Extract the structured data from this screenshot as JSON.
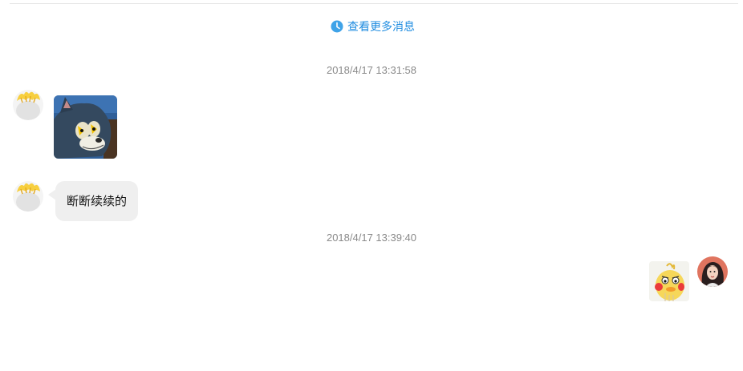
{
  "header": {
    "more_messages_label": "查看更多消息",
    "more_icon": "clock-icon",
    "accent_color": "#1f8ce0"
  },
  "timestamps": [
    "2018/4/17 13:31:58",
    "2018/4/17 13:39:40"
  ],
  "messages": [
    {
      "side": "left",
      "type": "image",
      "sticker": "tom-cat-sticker"
    },
    {
      "side": "left",
      "type": "text",
      "text": "断断续续的"
    },
    {
      "side": "right",
      "type": "image",
      "sticker": "yellow-duck-sticker"
    }
  ],
  "colors": {
    "bubble_bg": "#efefef",
    "timestamp_text": "#8a8a8a"
  }
}
